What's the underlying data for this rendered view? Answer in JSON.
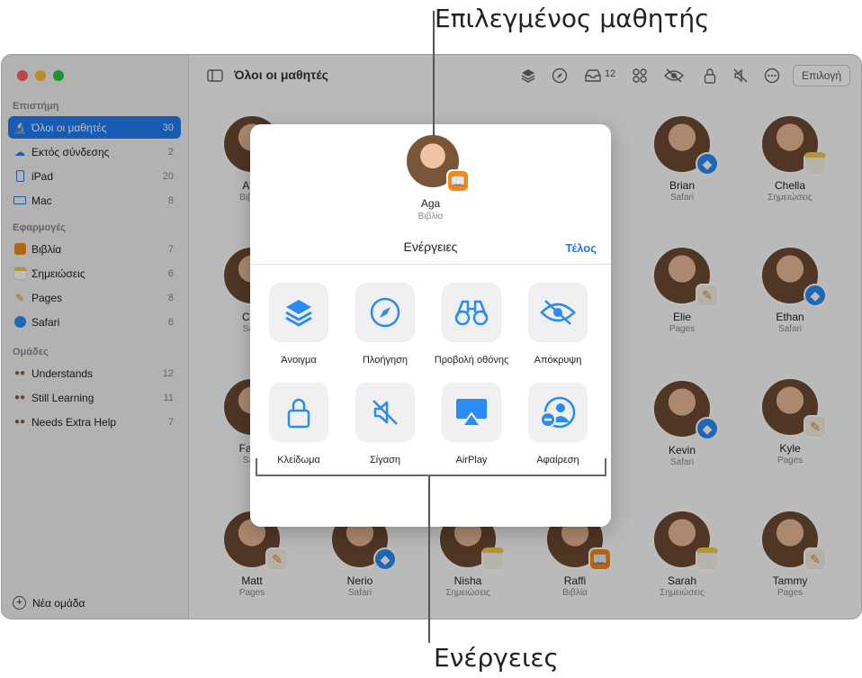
{
  "callouts": {
    "selected_student": "Επιλεγμένος μαθητής",
    "actions": "Ενέργειες"
  },
  "sidebar": {
    "sections": [
      {
        "title": "Επιστήμη",
        "items": [
          {
            "label": "Όλοι οι μαθητές",
            "count": "30",
            "icon": "graduation-icon",
            "selected": true
          },
          {
            "label": "Εκτός σύνδεσης",
            "count": "2",
            "icon": "cloud-offline-icon"
          },
          {
            "label": "iPad",
            "count": "20",
            "icon": "ipad-icon"
          },
          {
            "label": "Mac",
            "count": "8",
            "icon": "laptop-icon"
          }
        ]
      },
      {
        "title": "Εφαρμογές",
        "items": [
          {
            "label": "Βιβλία",
            "count": "7",
            "icon": "books-app-icon"
          },
          {
            "label": "Σημειώσεις",
            "count": "6",
            "icon": "notes-app-icon"
          },
          {
            "label": "Pages",
            "count": "8",
            "icon": "pages-app-icon"
          },
          {
            "label": "Safari",
            "count": "6",
            "icon": "safari-app-icon"
          }
        ]
      },
      {
        "title": "Ομάδες",
        "items": [
          {
            "label": "Understands",
            "count": "12",
            "icon": "group-icon"
          },
          {
            "label": "Still Learning",
            "count": "11",
            "icon": "group-icon"
          },
          {
            "label": "Needs Extra Help",
            "count": "7",
            "icon": "group-icon"
          }
        ]
      }
    ],
    "new_group": "Νέα ομάδα"
  },
  "toolbar": {
    "title": "Όλοι οι μαθητές",
    "inbox_count": "12",
    "select_label": "Επιλογή"
  },
  "students": [
    {
      "name": "Aga",
      "app": "Βιβλία",
      "badge": "books"
    },
    {
      "name": "Brian",
      "app": "Safari",
      "badge": "safari"
    },
    {
      "name": "Chella",
      "app": "Σημειώσεις",
      "badge": "notes"
    },
    {
      "name": "Chri",
      "app": "Safa",
      "badge": "safari"
    },
    {
      "name": "Elie",
      "app": "Pages",
      "badge": "pages"
    },
    {
      "name": "Ethan",
      "app": "Safari",
      "badge": "safari"
    },
    {
      "name": "Farra",
      "app": "Safa",
      "badge": "safari"
    },
    {
      "name": "Kevin",
      "app": "Safari",
      "badge": "safari"
    },
    {
      "name": "Kyle",
      "app": "Pages",
      "badge": "pages"
    },
    {
      "name": "Matt",
      "app": "Pages",
      "badge": "pages"
    },
    {
      "name": "Nerio",
      "app": "Safari",
      "badge": "safari"
    },
    {
      "name": "Nisha",
      "app": "Σημειώσεις",
      "badge": "notes"
    },
    {
      "name": "Raffi",
      "app": "Βιβλία",
      "badge": "books"
    },
    {
      "name": "Sarah",
      "app": "Σημειώσεις",
      "badge": "notes"
    },
    {
      "name": "Tammy",
      "app": "Pages",
      "badge": "pages"
    }
  ],
  "popover": {
    "student_name": "Aga",
    "student_app": "Βιβλία",
    "header": "Ενέργειες",
    "done": "Τέλος",
    "actions": [
      {
        "label": "Άνοιγμα",
        "icon": "layers-icon"
      },
      {
        "label": "Πλοήγηση",
        "icon": "compass-icon"
      },
      {
        "label": "Προβολή οθόνης",
        "icon": "binoculars-icon"
      },
      {
        "label": "Απόκρυψη",
        "icon": "eye-slash-icon"
      },
      {
        "label": "Κλείδωμα",
        "icon": "lock-icon"
      },
      {
        "label": "Σίγαση",
        "icon": "speaker-mute-icon"
      },
      {
        "label": "AirPlay",
        "icon": "airplay-icon"
      },
      {
        "label": "Αφαίρεση",
        "icon": "person-remove-icon"
      }
    ]
  },
  "colors": {
    "accent": "#1f7bf2",
    "action_icon": "#2a8cf3"
  }
}
